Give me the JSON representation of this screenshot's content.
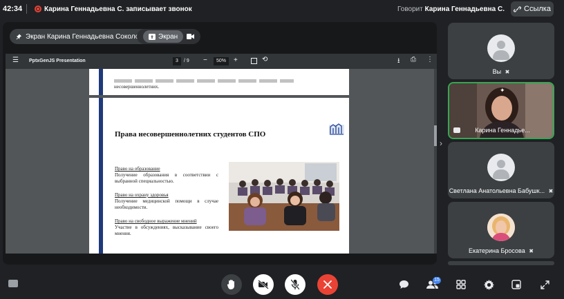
{
  "topbar": {
    "time": "42:34",
    "recording_text": "Карина Геннадьевна С. записывает звонок",
    "speaking_label": "Говорит",
    "speaking_name": "Карина Геннадьевна С.",
    "link_label": "Ссылка"
  },
  "stage": {
    "owner_chip": "Экран Карина Геннадьевна Соколова",
    "screen_chip": "Экран"
  },
  "pdf": {
    "title": "PptxGenJS Presentation",
    "page_current": "3",
    "page_total": "/ 9",
    "zoom": "50%"
  },
  "slide_prev": {
    "text": "несовершеннолетних."
  },
  "slide": {
    "title": "Права несовершеннолетних студентов СПО",
    "sections": [
      {
        "heading": "Право на образование",
        "body": "Получение образования в соответствии с выбранной специальностью."
      },
      {
        "heading": "Право на охрану здоровья",
        "body": "Получение медицинской помощи в случае необходимости."
      },
      {
        "heading": "Право на свободное выражение мнений",
        "body": "Участие в обсуждениях, высказывание своего мнения."
      }
    ]
  },
  "participants": [
    {
      "name": "Вы",
      "muted": true
    },
    {
      "name": "Карина Геннадье...",
      "muted": false,
      "speaking": true
    },
    {
      "name": "Светлана Анатольевна Бабушк...",
      "muted": true
    },
    {
      "name": "Екатерина Бросова",
      "muted": true
    }
  ],
  "controls": {
    "people_count": "15"
  },
  "colors": {
    "background": "#202124",
    "end_call": "#ea4335",
    "speaking_border": "#34a853",
    "slide_accent": "#1f3a7a"
  }
}
